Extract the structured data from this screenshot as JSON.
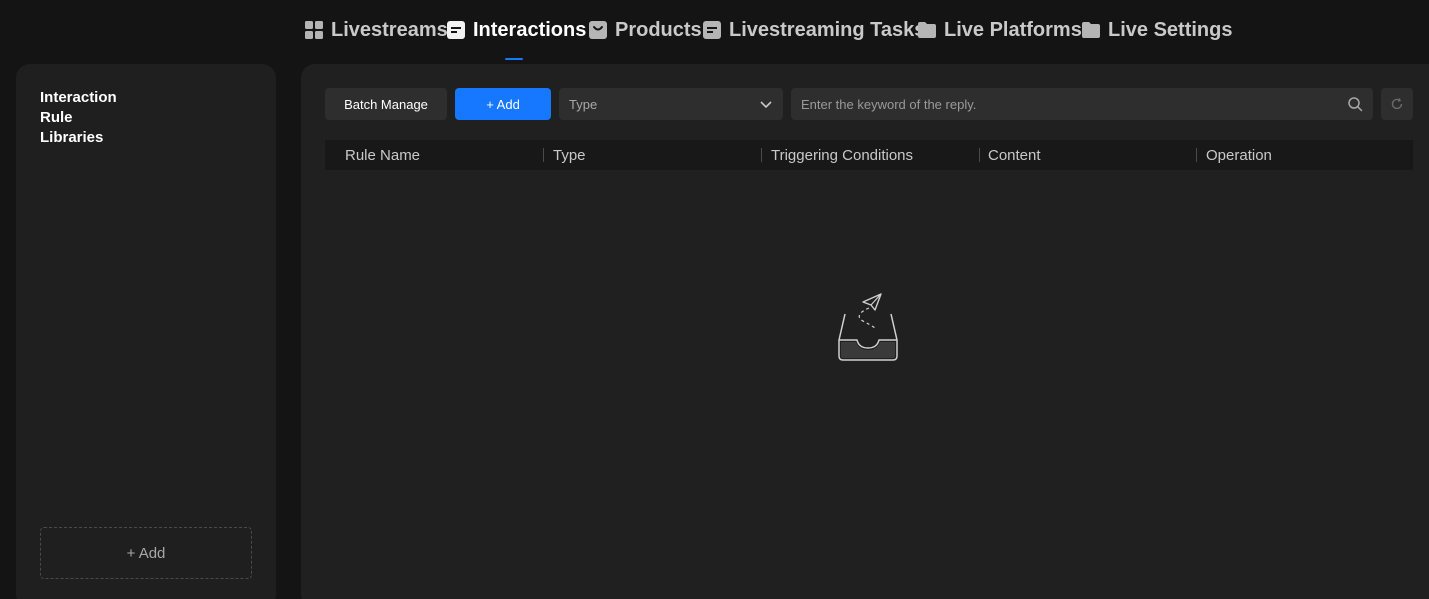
{
  "nav": {
    "tabs": [
      {
        "label": "Livestreams",
        "icon": "grid-icon"
      },
      {
        "label": "Interactions",
        "icon": "document-icon",
        "active": true
      },
      {
        "label": "Products",
        "icon": "shopping-bag-icon"
      },
      {
        "label": "Livestreaming Tasks",
        "icon": "document-icon"
      },
      {
        "label": "Live Platforms",
        "icon": "folder-icon"
      },
      {
        "label": "Live Settings",
        "icon": "folder-icon"
      }
    ]
  },
  "sidebar": {
    "title": "Interaction Rule Libraries",
    "add_label": "+ Add"
  },
  "toolbar": {
    "batch_label": "Batch Manage",
    "add_label": "+ Add",
    "type_placeholder": "Type",
    "search_placeholder": "Enter the keyword of the reply."
  },
  "table": {
    "columns": [
      "Rule Name",
      "Type",
      "Triggering Conditions",
      "Content",
      "Operation"
    ],
    "rows": []
  },
  "colors": {
    "accent": "#1677ff",
    "panel_bg": "#1f1f1f",
    "page_bg": "#141414"
  }
}
